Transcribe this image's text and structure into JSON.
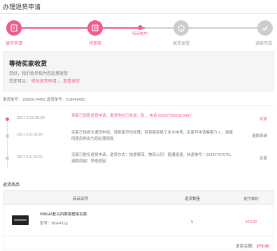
{
  "page": {
    "title": "办理退货申请"
  },
  "steps": {
    "accent": "#ef5b8a",
    "inactive": "#cccccc",
    "items": [
      {
        "label": "填写申请",
        "icon": "form-edit-icon",
        "state": "done"
      },
      {
        "label": "待审核",
        "icon": "shop-review-icon",
        "state": "done"
      },
      {
        "label": "退货发货",
        "icon": "package-return-icon",
        "state": "pending"
      },
      {
        "label": "退款完成",
        "icon": "checkmark-icon",
        "state": "pending"
      }
    ],
    "current_label": "待审核中"
  },
  "status": {
    "title": "等待买家收货",
    "line1": "您好，我们会尽快为您处理退货",
    "line2_prefix": "您还可以：",
    "link1": "修改退货申请",
    "link2": "查看退货"
  },
  "info": {
    "text": "退货单号：13680174450  退货单号：218940450"
  },
  "timeline": [
    {
      "time": "2017.5.13 00:30",
      "text": "卖家已同意退货申请，退货地址已发送：张 ，电话 09567706238 0467",
      "actor": "卖家",
      "active": true
    },
    {
      "time": "2017.5.5 18:29",
      "text": "买家已经提交退货申请，请卖家尽快处理，若卖家拒绝了本次申请，买家可申请客服介入，商家同意后将会为您处理退款",
      "actor": "退款系统",
      "active": false
    },
    {
      "time": "2017.5.5 16:25",
      "text": "买家已提交退货申请，退货方式：快递寄回，物流公司：圆通速递，快递单号：01437757678，退款原因：其他原因",
      "actor": "买家",
      "active": false
    }
  ],
  "goods": {
    "section_title": "退货商品",
    "headers": [
      "商品名称",
      "退货数量",
      "支付单价"
    ],
    "rows": [
      {
        "name": "WBGM复古风眼镜框架女款",
        "spec": "型号：BGF411g",
        "qty": "1",
        "price": "¥79.00"
      }
    ],
    "total_label": "退款金额：",
    "total_value": "¥79.00"
  }
}
